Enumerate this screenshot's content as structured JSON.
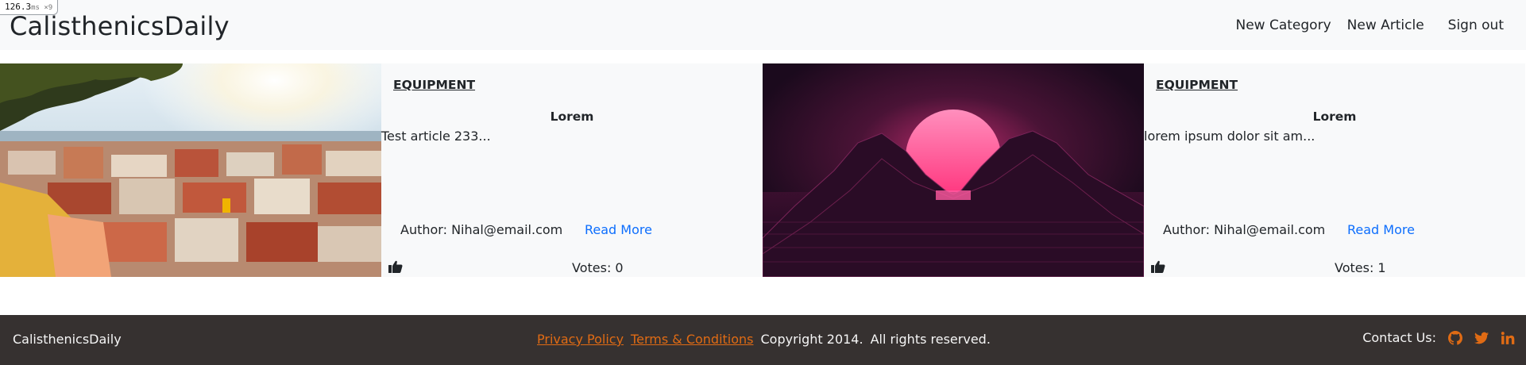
{
  "perf": {
    "value": "126.3",
    "unit": "ms ×9"
  },
  "navbar": {
    "brand": "CalisthenicsDaily",
    "links": [
      "New Category",
      "New Article",
      "Sign out"
    ]
  },
  "articles": [
    {
      "category": "EQUIPMENT",
      "title": "Lorem",
      "excerpt": "Test article 233...",
      "author": "Author: Nihal@email.com",
      "read_more": "Read More",
      "votes": "Votes: 0",
      "image": "city-rooftops-photo"
    },
    {
      "category": "EQUIPMENT",
      "title": "Lorem",
      "excerpt": "lorem ipsum dolor sit am...",
      "author": "Author: Nihal@email.com",
      "read_more": "Read More",
      "votes": "Votes: 1",
      "image": "synthwave-sunset-image"
    }
  ],
  "footer": {
    "brand": "CalisthenicsDaily",
    "privacy": "Privacy Policy",
    "terms": "Terms & Conditions",
    "copyright": "Copyright 2014.",
    "rights": "All rights reserved.",
    "contact": "Contact Us:",
    "social_icons": [
      "github-icon",
      "twitter-icon",
      "linkedin-icon"
    ],
    "accent": "#e06b14"
  },
  "colors": {
    "link": "#0d6efd",
    "navbar_bg": "#f8f9fa",
    "footer_bg": "#363130"
  }
}
